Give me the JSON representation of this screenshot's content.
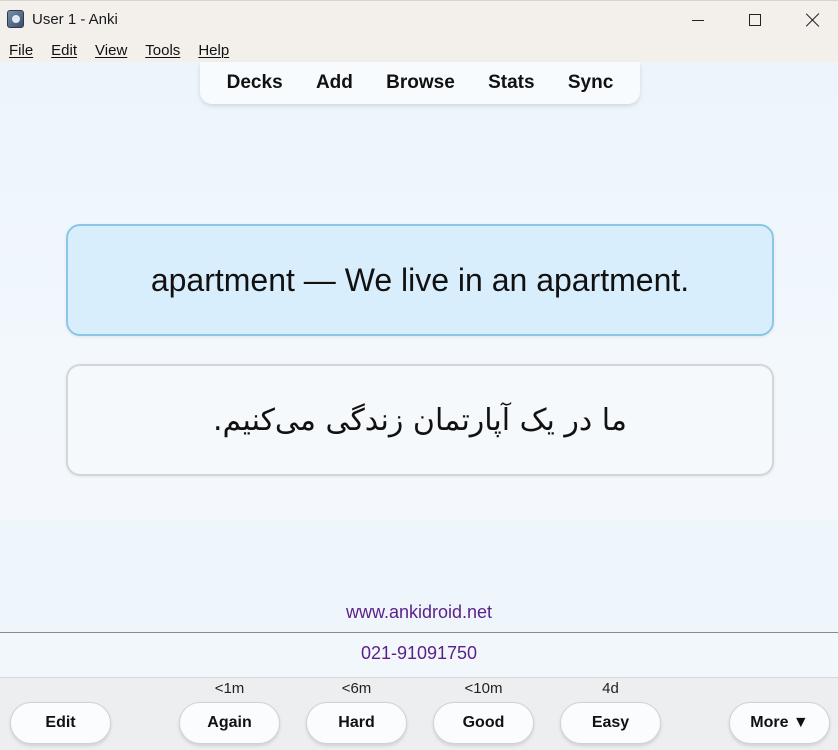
{
  "window": {
    "title": "User 1 - Anki"
  },
  "menu": {
    "items": [
      "File",
      "Edit",
      "View",
      "Tools",
      "Help"
    ]
  },
  "toolbar": {
    "links": [
      "Decks",
      "Add",
      "Browse",
      "Stats",
      "Sync"
    ]
  },
  "card": {
    "front": "apartment — We live in an apartment.",
    "back": "ما در یک آپارتمان زندگی می‌کنیم."
  },
  "footer": {
    "website": "www.ankidroid.net",
    "phone": "021-91091750"
  },
  "bottom_bar": {
    "edit_label": "Edit",
    "more_label": "More ▼",
    "answers": [
      {
        "label": "Again",
        "interval": "<1m"
      },
      {
        "label": "Hard",
        "interval": "<6m"
      },
      {
        "label": "Good",
        "interval": "<10m"
      },
      {
        "label": "Easy",
        "interval": "4d"
      }
    ]
  },
  "colors": {
    "front_card_bg": "#d8eefc",
    "front_card_border": "#8cc6e6",
    "link_color": "#5b1f8a"
  }
}
